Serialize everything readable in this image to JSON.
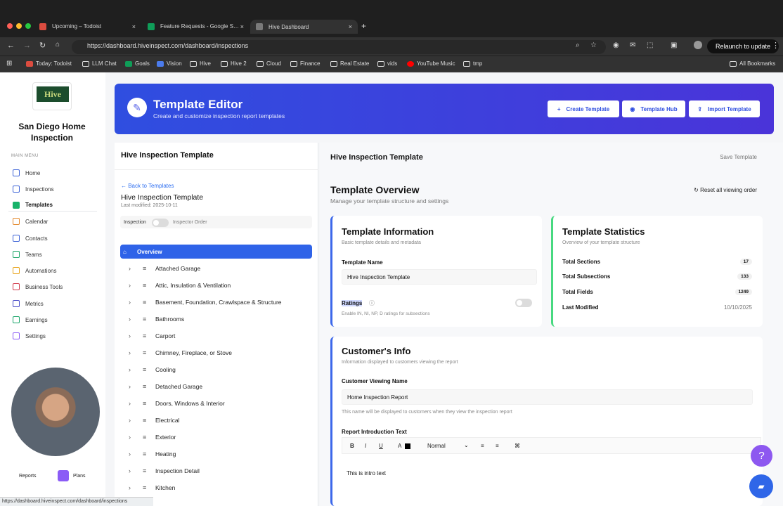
{
  "browser": {
    "tabs": [
      {
        "label": "Upcoming – Todoist",
        "color": "#db4c3f"
      },
      {
        "label": "Feature Requests - Google S…",
        "color": "#0f9d58"
      },
      {
        "label": "Hive Dashboard",
        "color": "#7a7a7a"
      }
    ],
    "url": "https://dashboard.hiveinspect.com/dashboard/inspections",
    "relaunch": "Relaunch to update",
    "bookmarks": [
      "Today: Todoist",
      "LLM Chat",
      "Goals",
      "Vision",
      "Hive",
      "Hive 2",
      "Cloud",
      "Finance",
      "Real Estate",
      "vids",
      "YouTube Music",
      "tmp",
      "All Bookmarks"
    ]
  },
  "sidebar": {
    "logo": "Hive",
    "company": "San Diego Home Inspection",
    "menu": "MAIN MENU",
    "items": [
      "Home",
      "Inspections",
      "Templates",
      "Calendar",
      "Contacts",
      "Teams",
      "Automations",
      "Business Tools",
      "Metrics",
      "Earnings",
      "Settings"
    ],
    "footer": [
      "Reports",
      "Plans"
    ]
  },
  "hero": {
    "title": "Template Editor",
    "subtitle": "Create and customize inspection report templates",
    "buttons": [
      "Create Template",
      "Template Hub",
      "Import Template"
    ]
  },
  "left": {
    "header": "Hive Inspection Template",
    "back": "← Back to Templates",
    "name": "Hive Inspection Template",
    "modified": "Last modified: 2025-10-11",
    "inspection": "Inspection",
    "inspector": "Inspector Order",
    "overview": "Overview",
    "sections": [
      "Attached Garage",
      "Attic, Insulation & Ventilation",
      "Basement, Foundation, Crawlspace & Structure",
      "Bathrooms",
      "Carport",
      "Chimney, Fireplace, or Stove",
      "Cooling",
      "Detached Garage",
      "Doors, Windows & Interior",
      "Electrical",
      "Exterior",
      "Heating",
      "Inspection Detail",
      "Kitchen"
    ]
  },
  "main": {
    "header": "Hive Inspection Template",
    "save": "Save Template",
    "overview_title": "Template Overview",
    "overview_sub": "Manage your template structure and settings",
    "reset": "Reset all viewing order",
    "info_title": "Template Information",
    "info_sub": "Basic template details and metadata",
    "name_label": "Template Name",
    "name_value": "Hive Inspection Template",
    "ratings": "Ratings",
    "ratings_sub": "Enable IN, NI, NP, D ratings for subsections",
    "stats_title": "Template Statistics",
    "stats_sub": "Overview of your template structure",
    "stats": [
      {
        "label": "Total Sections",
        "value": "17"
      },
      {
        "label": "Total Subsections",
        "value": "133"
      },
      {
        "label": "Total Fields",
        "value": "1249"
      },
      {
        "label": "Last Modified",
        "value": "10/10/2025"
      }
    ],
    "customer_title": "Customer's Info",
    "customer_sub": "Information displayed to customers viewing the report",
    "viewer_label": "Customer Viewing Name",
    "viewer_value": "Home Inspection Report",
    "viewer_help": "This name will be displayed to customers when they view the inspection report",
    "intro_label": "Report Introduction Text",
    "toolbar": [
      "B",
      "I",
      "U",
      "A",
      "Normal",
      "≡",
      "≡",
      "⌘"
    ],
    "intro_value": "This is intro text"
  },
  "status": "https://dashboard.hiveinspect.com/dashboard/inspections"
}
